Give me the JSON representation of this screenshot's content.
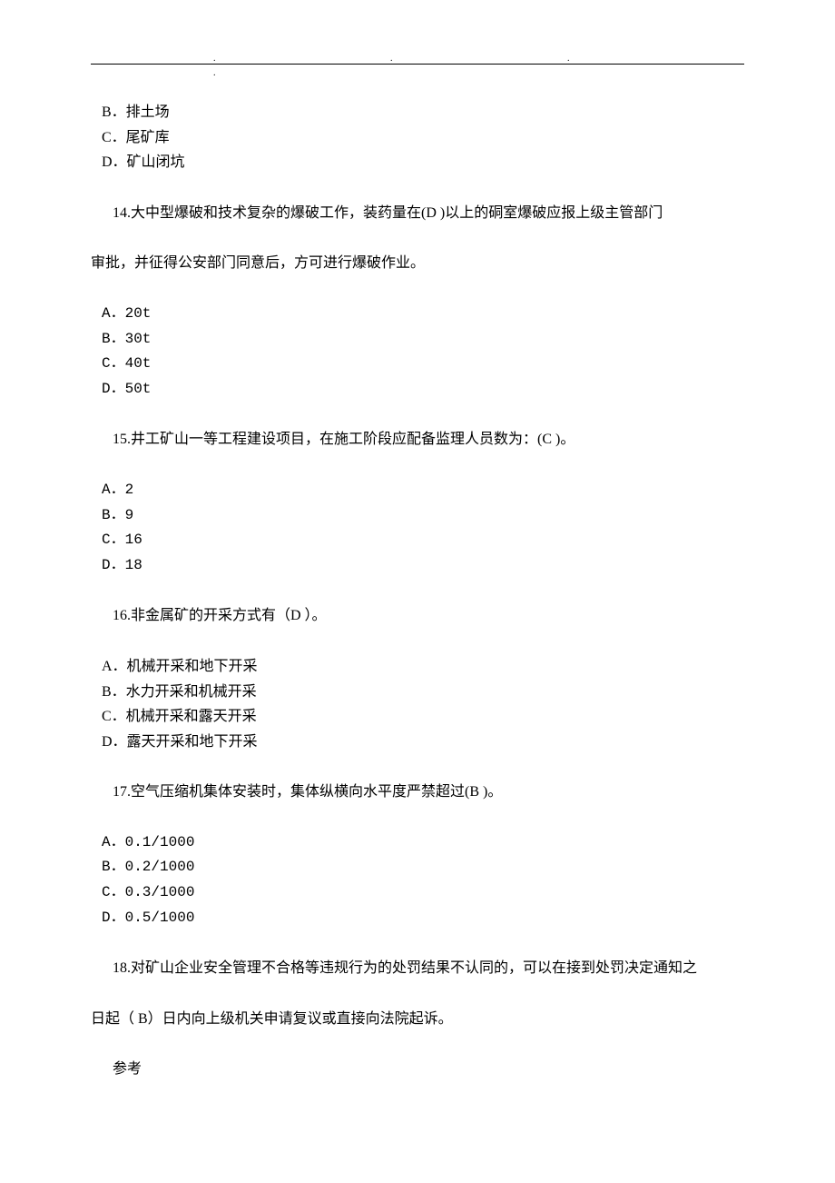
{
  "header_dots": ".    .    .    .",
  "q13": {
    "options": {
      "B": "B．排土场",
      "C": "C．尾矿库",
      "D": "D．矿山闭坑"
    }
  },
  "q14": {
    "text1": "14.大中型爆破和技术复杂的爆破工作，装药量在(D  )以上的硐室爆破应报上级主管部门",
    "text2": "审批，并征得公安部门同意后，方可进行爆破作业。",
    "options": {
      "A": "A．20t",
      "B": "B．30t",
      "C": "C．40t",
      "D": "D．50t"
    }
  },
  "q15": {
    "text": "15.井工矿山一等工程建设项目，在施工阶段应配备监理人员数为：(C  )。",
    "options": {
      "A": "A．2",
      "B": "B．9",
      "C": "C．16",
      "D": "D．18"
    }
  },
  "q16": {
    "text": "16.非金属矿的开采方式有（D  ）。",
    "options": {
      "A": "A．机械开采和地下开采",
      "B": "B．水力开采和机械开采",
      "C": "C．机械开采和露天开采",
      "D": "D．露天开采和地下开采"
    }
  },
  "q17": {
    "text": "17.空气压缩机集体安装时，集体纵横向水平度严禁超过(B  )。",
    "options": {
      "A": "A．0.1/1000",
      "B": "B．0.2/1000",
      "C": "C．0.3/1000",
      "D": "D．0.5/1000"
    }
  },
  "q18": {
    "text1": "18.对矿山企业安全管理不合格等违规行为的处罚结果不认同的，可以在接到处罚决定通知之",
    "text2": "日起（ B）日内向上级机关申请复议或直接向法院起诉。"
  },
  "footer": "参考"
}
